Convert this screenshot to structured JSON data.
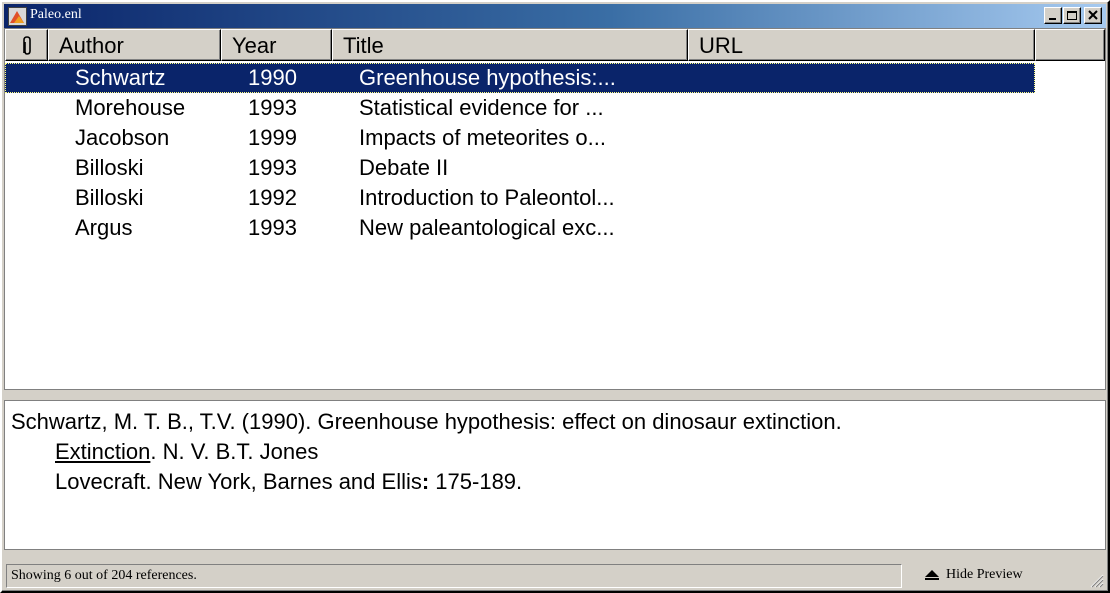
{
  "window": {
    "title": "Paleo.enl"
  },
  "columns": {
    "attachment_icon": "paperclip-icon",
    "author": "Author",
    "year": "Year",
    "title": "Title",
    "url": "URL"
  },
  "rows": [
    {
      "author": "Schwartz",
      "year": "1990",
      "title": "Greenhouse hypothesis:...",
      "selected": true
    },
    {
      "author": "Morehouse",
      "year": "1993",
      "title": "Statistical evidence for ..."
    },
    {
      "author": "Jacobson",
      "year": "1999",
      "title": "Impacts of meteorites o..."
    },
    {
      "author": "Billoski",
      "year": "1993",
      "title": "Debate II"
    },
    {
      "author": "Billoski",
      "year": "1992",
      "title": "Introduction to Paleontol..."
    },
    {
      "author": "Argus",
      "year": "1993",
      "title": "New paleantological exc..."
    }
  ],
  "preview": {
    "line1": "Schwartz, M. T. B., T.V. (1990). Greenhouse hypothesis: effect on dinosaur extinction.",
    "line2_underlined": "Extinction",
    "line2_rest": ". N. V. B.T. Jones",
    "line3_a": "Lovecraft. New York, Barnes and Ellis",
    "line3_bold": ":",
    "line3_b": " 175-189."
  },
  "status": {
    "text": "Showing 6 out of 204 references.",
    "hide_preview_label": "Hide Preview"
  },
  "colors": {
    "selection": "#0a246a",
    "titlebar_start": "#0a246a",
    "titlebar_end": "#a6caf0"
  }
}
